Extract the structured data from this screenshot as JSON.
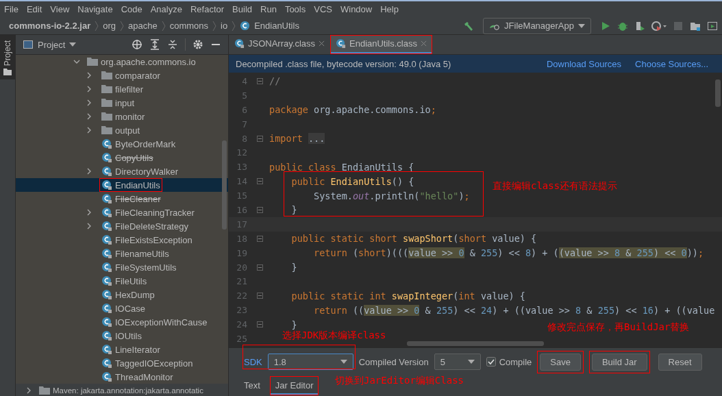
{
  "menu": [
    "File",
    "Edit",
    "View",
    "Navigate",
    "Code",
    "Analyze",
    "Refactor",
    "Build",
    "Run",
    "Tools",
    "VCS",
    "Window",
    "Help"
  ],
  "breadcrumb": [
    {
      "label": "commons-io-2.2.jar",
      "kind": "jar"
    },
    {
      "label": "org",
      "kind": "package"
    },
    {
      "label": "apache",
      "kind": "package"
    },
    {
      "label": "commons",
      "kind": "package"
    },
    {
      "label": "io",
      "kind": "package"
    },
    {
      "label": "EndianUtils",
      "kind": "class"
    }
  ],
  "run_config": "JFileManagerApp",
  "tool_strip": "Project",
  "project_panel": {
    "title": "Project",
    "tree": [
      {
        "label": "org.apache.commons.io",
        "kind": "package",
        "expanded": true,
        "children": [
          {
            "label": "comparator",
            "kind": "package",
            "expanded": false
          },
          {
            "label": "filefilter",
            "kind": "package",
            "expanded": false
          },
          {
            "label": "input",
            "kind": "package",
            "expanded": false
          },
          {
            "label": "monitor",
            "kind": "package",
            "expanded": false
          },
          {
            "label": "output",
            "kind": "package",
            "expanded": false
          },
          {
            "label": "ByteOrderMark",
            "kind": "class",
            "selected": false,
            "deprecated": false,
            "boxed": false
          },
          {
            "label": "CopyUtils",
            "kind": "class",
            "selected": false,
            "deprecated": true,
            "boxed": false
          },
          {
            "label": "DirectoryWalker",
            "kind": "class",
            "expanded": false,
            "selected": false,
            "deprecated": false,
            "boxed": false
          },
          {
            "label": "EndianUtils",
            "kind": "class",
            "selected": true,
            "deprecated": false,
            "boxed": true
          },
          {
            "label": "FileCleaner",
            "kind": "class",
            "selected": false,
            "deprecated": true,
            "boxed": false
          },
          {
            "label": "FileCleaningTracker",
            "kind": "class",
            "expanded": false,
            "selected": false,
            "deprecated": false,
            "boxed": false
          },
          {
            "label": "FileDeleteStrategy",
            "kind": "class",
            "expanded": false,
            "selected": false,
            "deprecated": false,
            "boxed": false
          },
          {
            "label": "FileExistsException",
            "kind": "class",
            "selected": false,
            "deprecated": false,
            "boxed": false
          },
          {
            "label": "FilenameUtils",
            "kind": "class",
            "selected": false,
            "deprecated": false,
            "boxed": false
          },
          {
            "label": "FileSystemUtils",
            "kind": "class",
            "selected": false,
            "deprecated": false,
            "boxed": false
          },
          {
            "label": "FileUtils",
            "kind": "class",
            "selected": false,
            "deprecated": false,
            "boxed": false
          },
          {
            "label": "HexDump",
            "kind": "class",
            "selected": false,
            "deprecated": false,
            "boxed": false
          },
          {
            "label": "IOCase",
            "kind": "class",
            "selected": false,
            "deprecated": false,
            "boxed": false
          },
          {
            "label": "IOExceptionWithCause",
            "kind": "class",
            "selected": false,
            "deprecated": false,
            "boxed": false
          },
          {
            "label": "IOUtils",
            "kind": "class",
            "selected": false,
            "deprecated": false,
            "boxed": false
          },
          {
            "label": "LineIterator",
            "kind": "class",
            "selected": false,
            "deprecated": false,
            "boxed": false
          },
          {
            "label": "TaggedIOException",
            "kind": "class",
            "selected": false,
            "deprecated": false,
            "boxed": false
          },
          {
            "label": "ThreadMonitor",
            "kind": "class",
            "selected": false,
            "deprecated": false,
            "boxed": false
          }
        ]
      }
    ],
    "footer_row": "Maven: jakarta.annotation:jakarta.annotatic"
  },
  "editor_tabs": [
    {
      "label": "JSONArray.class",
      "selected": false,
      "boxed": false
    },
    {
      "label": "EndianUtils.class",
      "selected": true,
      "boxed": true
    }
  ],
  "info_bar": {
    "message": "Decompiled .class file, bytecode version: 49.0 (Java 5)",
    "links": [
      "Download Sources",
      "Choose Sources..."
    ]
  },
  "code": [
    {
      "num": "4",
      "fold": true,
      "tokens": [
        {
          "t": "//",
          "kind": "comment"
        }
      ]
    },
    {
      "num": "5"
    },
    {
      "num": "6",
      "tokens": [
        {
          "t": "package",
          "kind": "kw"
        },
        {
          "t": " org.apache.commons.io",
          "kind": "plain"
        },
        {
          "t": ";",
          "kind": "kw"
        }
      ]
    },
    {
      "num": "7"
    },
    {
      "num": "8",
      "fold": true,
      "tokens": [
        {
          "t": "import ",
          "kind": "kw"
        },
        {
          "t": "...",
          "kind": "folded"
        }
      ]
    },
    {
      "num": "12"
    },
    {
      "num": "13",
      "tokens": [
        {
          "t": "public class ",
          "kind": "kw"
        },
        {
          "t": "EndianUtils {",
          "kind": "plain"
        }
      ]
    },
    {
      "num": "14",
      "fold": true,
      "tokens": [
        {
          "t": "    public ",
          "kind": "kw"
        },
        {
          "t": "EndianUtils",
          "kind": "fn"
        },
        {
          "t": "() {",
          "kind": "plain"
        }
      ]
    },
    {
      "num": "15",
      "tokens": [
        {
          "t": "        System.",
          "kind": "plain"
        },
        {
          "t": "out",
          "kind": "field"
        },
        {
          "t": ".println(",
          "kind": "plain"
        },
        {
          "t": "\"hello\"",
          "kind": "str"
        },
        {
          "t": ")",
          "kind": "plain"
        },
        {
          "t": ";",
          "kind": "kw"
        }
      ]
    },
    {
      "num": "16",
      "fold": true,
      "tokens": [
        {
          "t": "    }",
          "kind": "plain"
        }
      ]
    },
    {
      "num": "17",
      "current": true
    },
    {
      "num": "18",
      "fold": true,
      "tokens": [
        {
          "t": "    public static short ",
          "kind": "kw"
        },
        {
          "t": "swapShort",
          "kind": "fn"
        },
        {
          "t": "(",
          "kind": "plain"
        },
        {
          "t": "short ",
          "kind": "kw"
        },
        {
          "t": "value) {",
          "kind": "plain"
        }
      ]
    },
    {
      "num": "19",
      "tokens": [
        {
          "t": "        return ",
          "kind": "kw"
        },
        {
          "t": "(",
          "kind": "plain"
        },
        {
          "t": "short",
          "kind": "kw"
        },
        {
          "t": ")(((",
          "kind": "plain"
        },
        {
          "t": "value >> ",
          "kind": "hl"
        },
        {
          "t": "0",
          "kind": "hlnum"
        },
        {
          "t": " & ",
          "kind": "plain"
        },
        {
          "t": "255",
          "kind": "num"
        },
        {
          "t": ") << ",
          "kind": "plain"
        },
        {
          "t": "8",
          "kind": "num"
        },
        {
          "t": ") + (",
          "kind": "plain"
        },
        {
          "t": "(value >> ",
          "kind": "hl"
        },
        {
          "t": "8",
          "kind": "hlnum"
        },
        {
          "t": " & ",
          "kind": "hl"
        },
        {
          "t": "255",
          "kind": "hlnum"
        },
        {
          "t": ") << ",
          "kind": "hl"
        },
        {
          "t": "0",
          "kind": "hlnum"
        },
        {
          "t": "))",
          "kind": "plain"
        },
        {
          "t": ";",
          "kind": "kw"
        }
      ]
    },
    {
      "num": "20",
      "fold": true,
      "tokens": [
        {
          "t": "    }",
          "kind": "plain"
        }
      ]
    },
    {
      "num": "21"
    },
    {
      "num": "22",
      "fold": true,
      "tokens": [
        {
          "t": "    public static int ",
          "kind": "kw"
        },
        {
          "t": "swapInteger",
          "kind": "fn"
        },
        {
          "t": "(",
          "kind": "plain"
        },
        {
          "t": "int ",
          "kind": "kw"
        },
        {
          "t": "value) {",
          "kind": "plain"
        }
      ]
    },
    {
      "num": "23",
      "tokens": [
        {
          "t": "        return ",
          "kind": "kw"
        },
        {
          "t": "((",
          "kind": "plain"
        },
        {
          "t": "value >> ",
          "kind": "hl"
        },
        {
          "t": "0",
          "kind": "hlnum"
        },
        {
          "t": " & ",
          "kind": "plain"
        },
        {
          "t": "255",
          "kind": "num"
        },
        {
          "t": ") << ",
          "kind": "plain"
        },
        {
          "t": "24",
          "kind": "num"
        },
        {
          "t": ") + ((value >> ",
          "kind": "plain"
        },
        {
          "t": "8",
          "kind": "num"
        },
        {
          "t": " & ",
          "kind": "plain"
        },
        {
          "t": "255",
          "kind": "num"
        },
        {
          "t": ") << ",
          "kind": "plain"
        },
        {
          "t": "16",
          "kind": "num"
        },
        {
          "t": ") + ((value",
          "kind": "plain"
        }
      ]
    },
    {
      "num": "24",
      "fold": true,
      "tokens": [
        {
          "t": "    }",
          "kind": "plain"
        }
      ]
    },
    {
      "num": "25"
    }
  ],
  "jar_editor": {
    "sdk_label": "SDK",
    "sdk_value": "1.8",
    "compiled_label": "Compiled Version",
    "compiled_value": "5",
    "compile": {
      "label": "Compile",
      "checked": true
    },
    "buttons": [
      {
        "label": "Save",
        "boxed": true
      },
      {
        "label": "Build Jar",
        "boxed": true
      },
      {
        "label": "Reset"
      }
    ]
  },
  "bottom_tabs": [
    {
      "label": "Text",
      "selected": false,
      "boxed": false
    },
    {
      "label": "Jar Editor",
      "selected": true,
      "boxed": true
    }
  ],
  "annotations": [
    {
      "kind": "code",
      "text": "直接编辑class还有语法提示"
    },
    {
      "kind": "sdk",
      "text": "选择JDK版本编译class"
    },
    {
      "kind": "save",
      "text": "修改完点保存，再BuildJar替换"
    },
    {
      "kind": "tab",
      "text": "切换到JarEditor编辑Class"
    }
  ]
}
